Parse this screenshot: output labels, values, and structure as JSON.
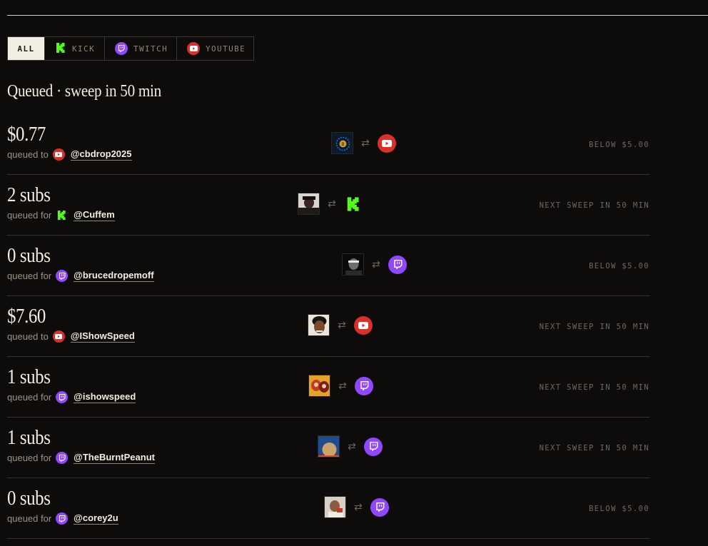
{
  "filters": [
    {
      "label": "ALL",
      "icon": "",
      "active": true
    },
    {
      "label": "KICK",
      "icon": "kick-icon",
      "active": false
    },
    {
      "label": "TWITCH",
      "icon": "twitch-icon",
      "active": false
    },
    {
      "label": "YOUTUBE",
      "icon": "youtube-icon",
      "active": false
    }
  ],
  "section_title": "Queued · sweep in 50 min",
  "rows": [
    {
      "amount": "$0.77",
      "prefix": "queued to",
      "platform": "youtube",
      "handle": "@cbdrop2025",
      "status": "BELOW $5.00",
      "avatar": "coin-logo"
    },
    {
      "amount": "2 subs",
      "prefix": "queued for",
      "platform": "kick",
      "handle": "@Cuffem",
      "status": "NEXT SWEEP IN 50 MIN",
      "avatar": "person-dark"
    },
    {
      "amount": "0 subs",
      "prefix": "queued for",
      "platform": "twitch",
      "handle": "@brucedropemoff",
      "status": "BELOW $5.00",
      "avatar": "person-bw"
    },
    {
      "amount": "$7.60",
      "prefix": "queued to",
      "platform": "youtube",
      "handle": "@IShowSpeed",
      "status": "NEXT SWEEP IN 50 MIN",
      "avatar": "person-speed"
    },
    {
      "amount": "1 subs",
      "prefix": "queued for",
      "platform": "twitch",
      "handle": "@ishowspeed",
      "status": "NEXT SWEEP IN 50 MIN",
      "avatar": "anime"
    },
    {
      "amount": "1 subs",
      "prefix": "queued for",
      "platform": "twitch",
      "handle": "@TheBurntPeanut",
      "status": "NEXT SWEEP IN 50 MIN",
      "avatar": "peanut"
    },
    {
      "amount": "0 subs",
      "prefix": "queued for",
      "platform": "twitch",
      "handle": "@corey2u",
      "status": "BELOW $5.00",
      "avatar": "person-light"
    }
  ],
  "colors": {
    "youtube": "#d8302b",
    "twitch": "#9146ff",
    "kick": "#53fc18"
  }
}
